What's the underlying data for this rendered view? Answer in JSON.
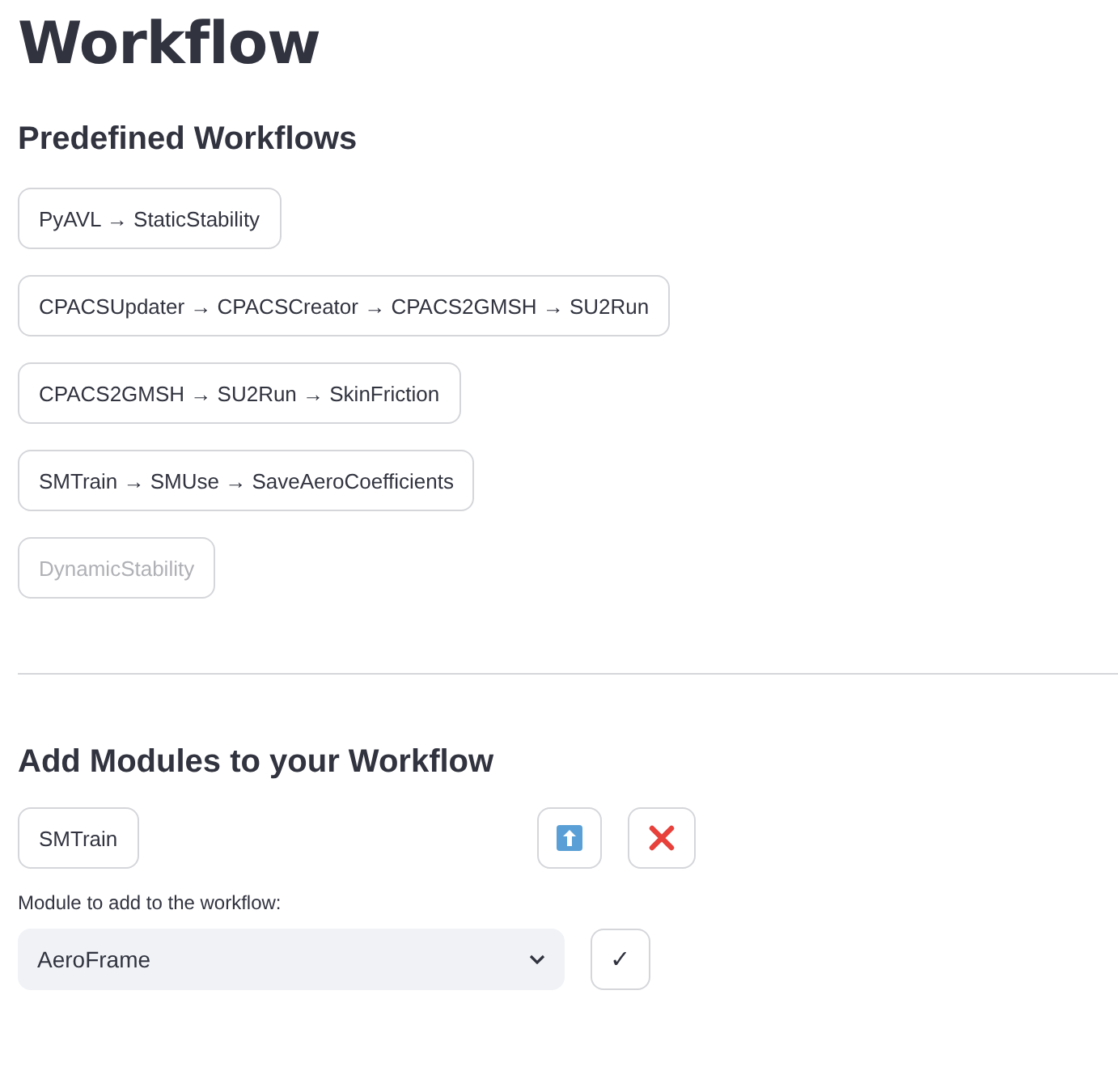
{
  "title": "Workflow",
  "predefined": {
    "heading": "Predefined Workflows",
    "workflows": [
      {
        "label": "PyAVL → StaticStability",
        "disabled": false
      },
      {
        "label": "CPACSUpdater → CPACSCreator → CPACS2GMSH → SU2Run",
        "disabled": false
      },
      {
        "label": "CPACS2GMSH → SU2Run → SkinFriction",
        "disabled": false
      },
      {
        "label": "SMTrain → SMUse → SaveAeroCoefficients",
        "disabled": false
      },
      {
        "label": "DynamicStability",
        "disabled": true
      }
    ]
  },
  "add_modules": {
    "heading": "Add Modules to your Workflow",
    "modules": [
      {
        "label": "SMTrain"
      }
    ],
    "select": {
      "label": "Module to add to the workflow:",
      "value": "AeroFrame"
    },
    "confirm": "✓"
  }
}
